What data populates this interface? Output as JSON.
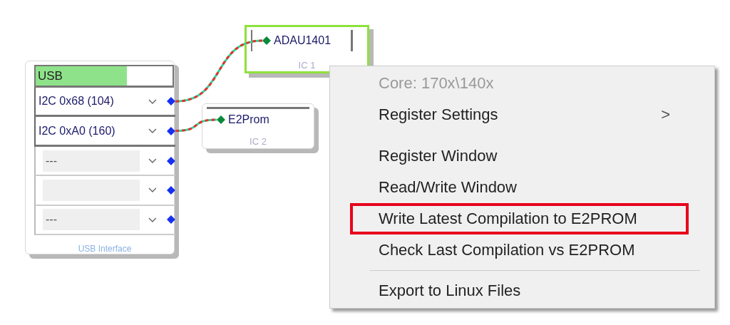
{
  "blocks": [
    {
      "kind": "usb",
      "header": "USB",
      "footer": "USB Interface",
      "rows": [
        {
          "value": "I2C 0x68 (104)",
          "active": true,
          "wired": true
        },
        {
          "value": "I2C 0xA0 (160)",
          "active": true,
          "wired": true
        },
        {
          "value": "---",
          "active": false,
          "wired": false
        },
        {
          "active": false,
          "wired": false
        },
        {
          "value": "---",
          "active": false,
          "wired": false
        }
      ]
    },
    {
      "kind": "ic",
      "name": "ADAU1401",
      "label": "IC 1",
      "selected": true
    },
    {
      "kind": "ic",
      "name": "E2Prom",
      "label": "IC 2",
      "selected": false
    }
  ],
  "context_menu": {
    "groups": [
      {
        "divider_above": false,
        "items": [
          {
            "label": "Core: 170x\\140x",
            "disabled": true,
            "highlighted": false
          },
          {
            "label": "Register Settings",
            "disabled": false,
            "highlighted": false,
            "submenu": ">"
          }
        ]
      },
      {
        "divider_above": false,
        "items": [
          {
            "label": "Register Window",
            "disabled": false,
            "highlighted": false
          },
          {
            "label": "Read/Write Window",
            "disabled": false,
            "highlighted": false
          },
          {
            "label": "Write Latest Compilation to E2PROM",
            "disabled": false,
            "highlighted": true
          },
          {
            "label": "Check Last Compilation vs E2PROM",
            "disabled": false,
            "highlighted": false
          }
        ]
      },
      {
        "divider_above": true,
        "items": [
          {
            "label": "Export to Linux Files",
            "disabled": false,
            "highlighted": false
          }
        ]
      }
    ]
  }
}
